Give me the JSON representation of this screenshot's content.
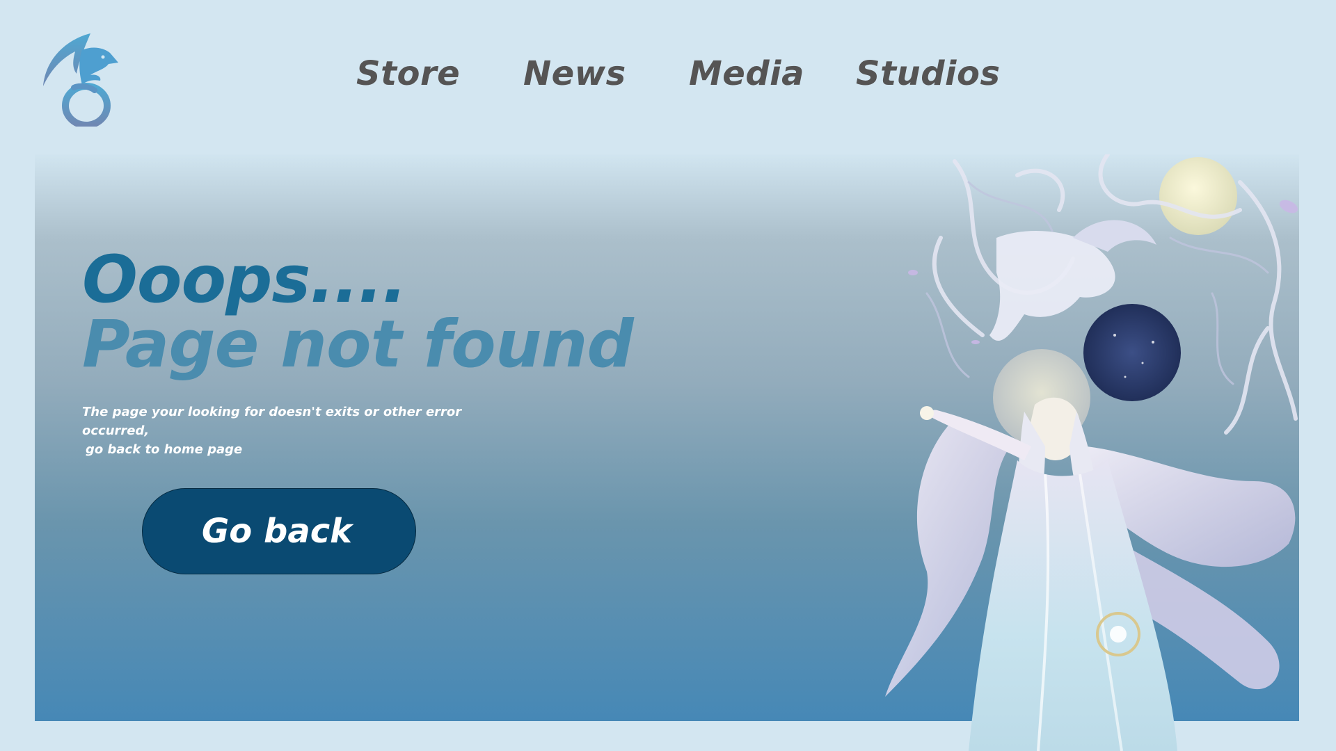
{
  "header": {
    "logo_icon": "dragon-logo-icon",
    "nav": [
      {
        "label": "Store"
      },
      {
        "label": "News"
      },
      {
        "label": "Media"
      },
      {
        "label": "Studios"
      }
    ]
  },
  "hero": {
    "headline": "Ooops....",
    "subhead": "Page not found",
    "message_line1": "The page your looking for doesn't exits or other error occurred,",
    "message_line2": "go back to home page",
    "button_label": "Go back",
    "illustration_icon": "fantasy-character-illustration"
  },
  "colors": {
    "background": "#d3e6f1",
    "headline": "#1b6d97",
    "subhead": "#4a8cae",
    "button": "#0a4a72",
    "nav_text": "#555454"
  }
}
